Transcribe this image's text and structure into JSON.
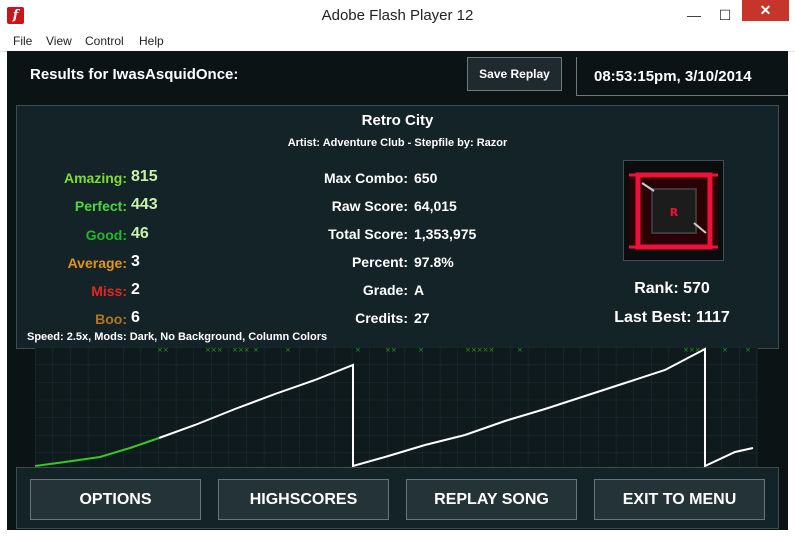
{
  "window": {
    "title": "Adobe Flash Player 12",
    "app_icon": "f",
    "minimize": "—",
    "maximize": "☐",
    "close": "✕"
  },
  "menu": [
    "File",
    "View",
    "Control",
    "Help"
  ],
  "header": {
    "results_for": "Results for IwasAsquidOnce:",
    "save_replay": "Save Replay",
    "datetime": "08:53:15pm, 3/10/2014"
  },
  "song": {
    "title": "Retro City",
    "subtitle": "Artist: Adventure Club  -  Stepfile by: Razor"
  },
  "judgements": [
    {
      "label": "Amazing:",
      "value": "815",
      "color": "#7cdd2f"
    },
    {
      "label": "Perfect:",
      "value": "443",
      "color": "#4bd83c"
    },
    {
      "label": "Good:",
      "value": "46",
      "color": "#23b72a"
    },
    {
      "label": "Average:",
      "value": "3",
      "color": "#e5931b"
    },
    {
      "label": "Miss:",
      "value": "2",
      "color": "#e52620"
    },
    {
      "label": "Boo:",
      "value": "6",
      "color": "#b0781e"
    }
  ],
  "stats": [
    {
      "label": "Max Combo:",
      "value": "650"
    },
    {
      "label": "Raw Score:",
      "value": "64,015"
    },
    {
      "label": "Total Score:",
      "value": "1,353,975"
    },
    {
      "label": "Percent:",
      "value": "97.8%"
    },
    {
      "label": "Grade:",
      "value": "A"
    },
    {
      "label": "Credits:",
      "value": "27"
    }
  ],
  "thumbnail": {
    "letter": "R"
  },
  "rank": "Rank: 570",
  "last_best": "Last Best: 1117",
  "speed": "Speed: 2.5x, Mods: Dark, No Background, Column Colors",
  "buttons": [
    "OPTIONS",
    "HIGHSCORES",
    "REPLAY SONG",
    "EXIT TO MENU"
  ]
}
